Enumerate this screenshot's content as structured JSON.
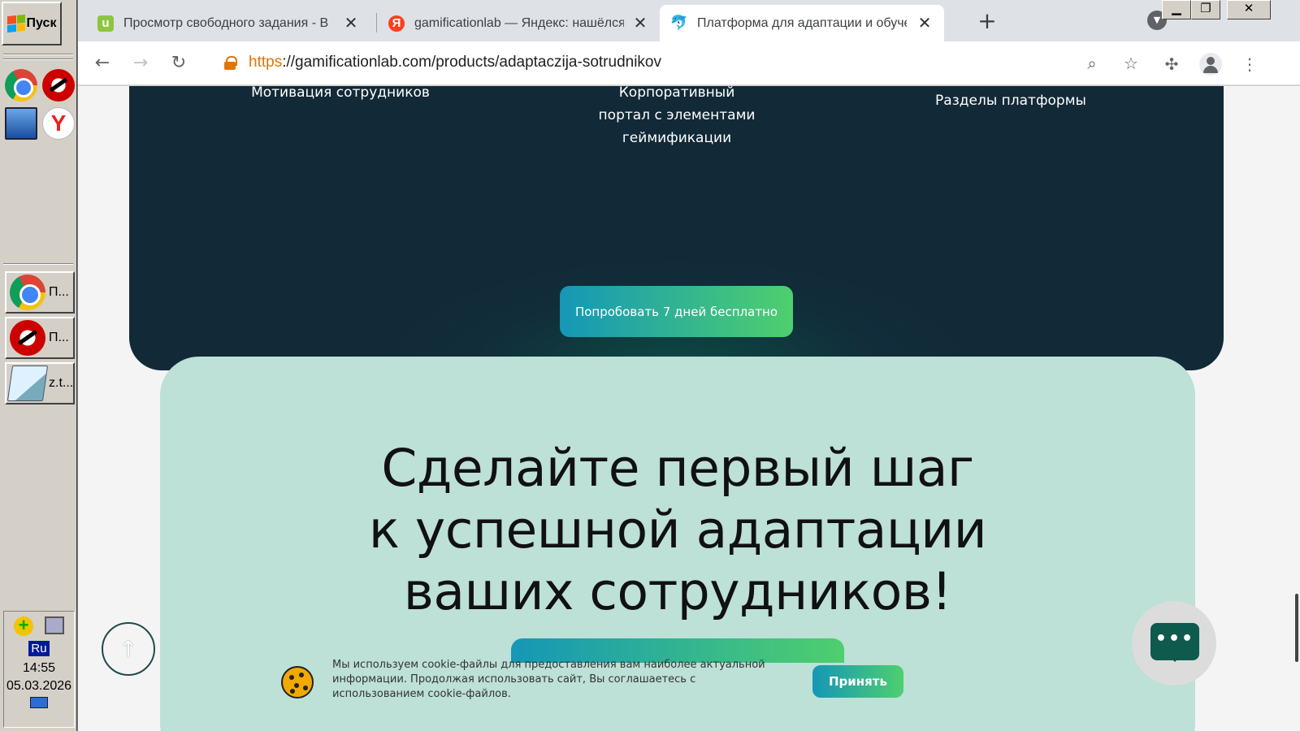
{
  "taskbar": {
    "start_label": "Пуск",
    "tasks": [
      {
        "label": "П...",
        "icon": "chrome-icon"
      },
      {
        "label": "П...",
        "icon": "opera-icon"
      },
      {
        "label": "z.t...",
        "icon": "notepad-icon"
      }
    ],
    "tray": {
      "language": "Ru",
      "time": "14:55",
      "date": "05.03.2026"
    }
  },
  "browser": {
    "tabs": [
      {
        "title": "Просмотр свободного задания - В",
        "favicon": "u-favicon",
        "active": false
      },
      {
        "title": "gamificationlab — Яндекс: нашёлся",
        "favicon": "yandex-favicon",
        "active": false
      },
      {
        "title": "Платформа для адаптации и обуче",
        "favicon": "gamificationlab-favicon",
        "active": true
      }
    ],
    "url_scheme": "https",
    "url_rest": "://gamificationlab.com/products/adaptaczija-sotrudnikov"
  },
  "page": {
    "dark_section": {
      "label_left": "Мотивация сотрудников",
      "label_center": [
        "Корпоративный",
        "портал с элементами",
        "геймификации"
      ],
      "label_right": "Разделы платформы",
      "cta": "Попробовать 7 дней бесплатно"
    },
    "green_section": {
      "heading": [
        "Сделайте первый шаг",
        "к успешной адаптации",
        "ваших сотрудников!"
      ]
    },
    "cookie": {
      "text": "Мы используем cookie-файлы для предоставления вам наиболее актуальной информации. Продолжая использовать сайт, Вы соглашаетесь с использованием cookie-файлов.",
      "accept": "Принять"
    },
    "colors": {
      "accent_start": "#1597b7",
      "accent_end": "#4ecf6e",
      "dark_bg": "#122937",
      "mint_bg": "#bde0d7"
    }
  }
}
